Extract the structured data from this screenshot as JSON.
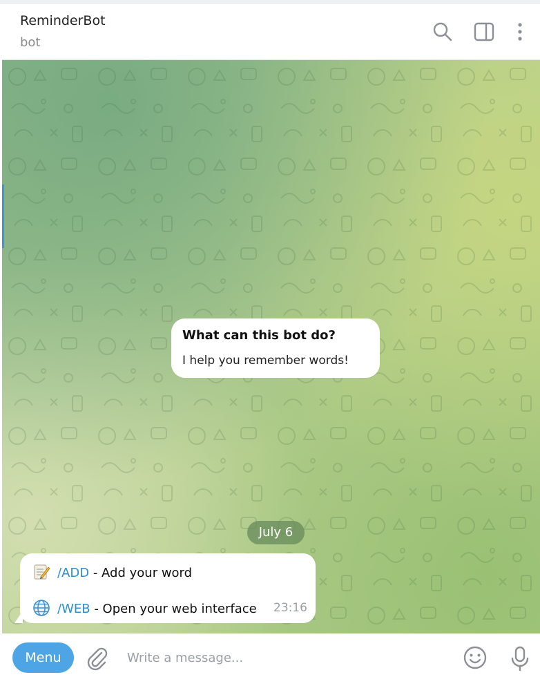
{
  "header": {
    "title": "ReminderBot",
    "subtitle": "bot",
    "icons": [
      "search-icon",
      "sidebar-toggle-icon",
      "more-vertical-icon"
    ]
  },
  "intro_card": {
    "title": "What can this bot do?",
    "text": "I help you remember words!"
  },
  "date_separator": "July 6",
  "message": {
    "lines": [
      {
        "emoji": "memo-icon",
        "command": "/ADD",
        "text": " - Add your word"
      },
      {
        "emoji": "globe-icon",
        "command": "/WEB",
        "text": " - Open your web interface"
      }
    ],
    "time": "23:16"
  },
  "composer": {
    "menu_label": "Menu",
    "placeholder": "Write a message..."
  },
  "colors": {
    "accent": "#4ea5e6",
    "link": "#2b8fd3",
    "chat_background": "#a9c98a"
  }
}
